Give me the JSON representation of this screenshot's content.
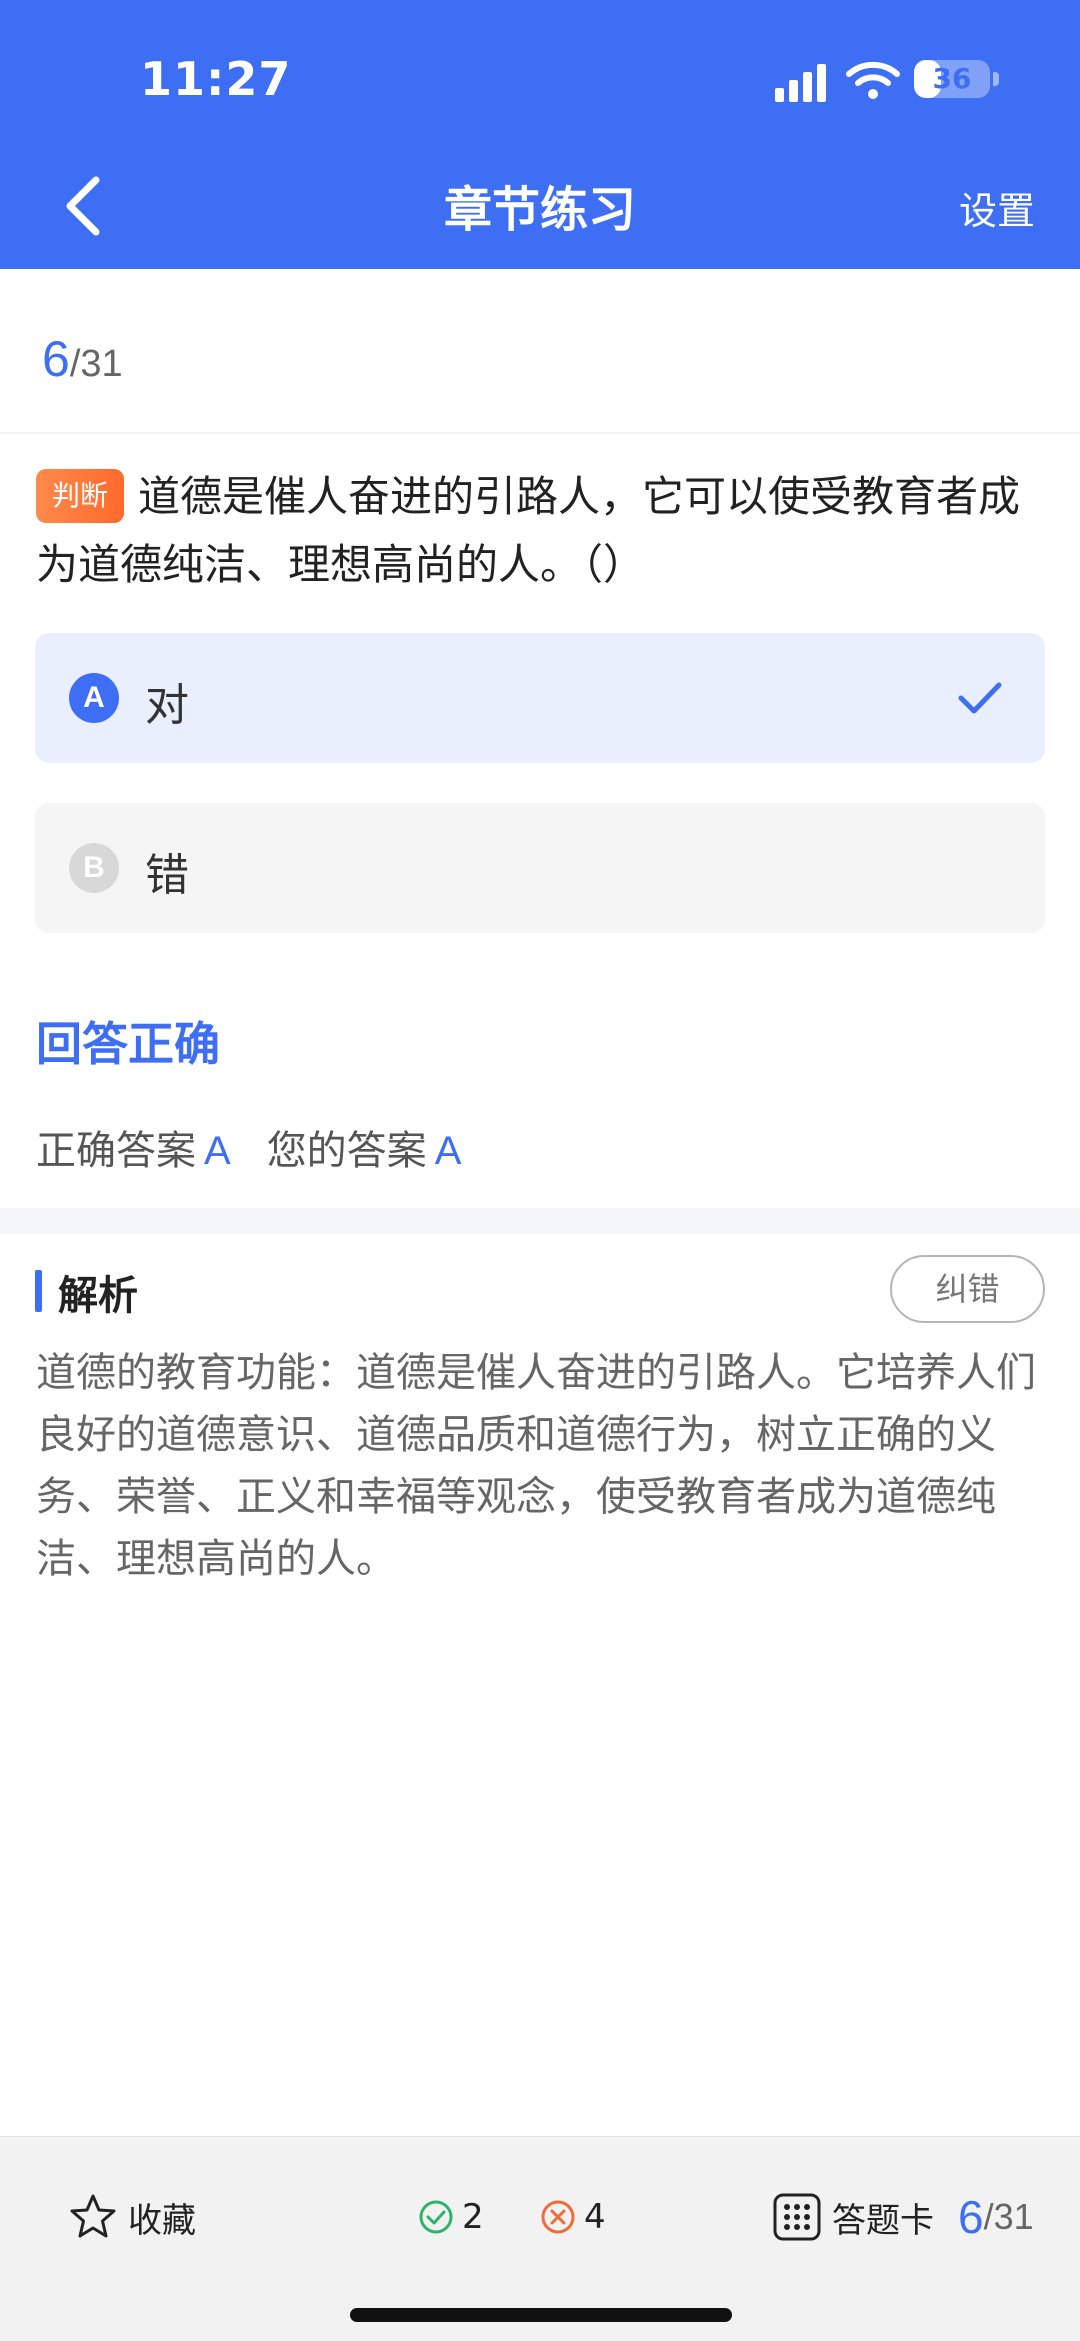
{
  "status_bar": {
    "time": "11:27",
    "battery": "36",
    "battery_level": 0.36
  },
  "nav": {
    "title": "章节练习",
    "settings": "设置",
    "back_icon": "chevron-left-icon"
  },
  "progress": {
    "current": "6",
    "total": "/31"
  },
  "question": {
    "type_tag": "判断",
    "text": "道德是催人奋进的引路人，它可以使受教育者成为道德纯洁、理想高尚的人。（）"
  },
  "options": [
    {
      "key": "A",
      "text": "对",
      "selected": true
    },
    {
      "key": "B",
      "text": "错",
      "selected": false
    }
  ],
  "result": {
    "title": "回答正确",
    "correct_label": "正确答案",
    "correct_value": "A",
    "your_label": "您的答案",
    "your_value": "A"
  },
  "analysis": {
    "title": "解析",
    "report_label": "纠错",
    "text": "道德的教育功能：道德是催人奋进的引路人。它培养人们良好的道德意识、道德品质和道德行为，树立正确的义务、荣誉、正义和幸福等观念，使受教育者成为道德纯洁、理想高尚的人。"
  },
  "bottom_bar": {
    "favorite_label": "收藏",
    "right_count": "2",
    "wrong_count": "4",
    "card_label": "答题卡",
    "current": "6",
    "total": "/31"
  },
  "colors": {
    "accent": "#3e6ef4",
    "tag": "#ff7a3d",
    "right": "#2fb36b",
    "wrong": "#f06a3a"
  }
}
